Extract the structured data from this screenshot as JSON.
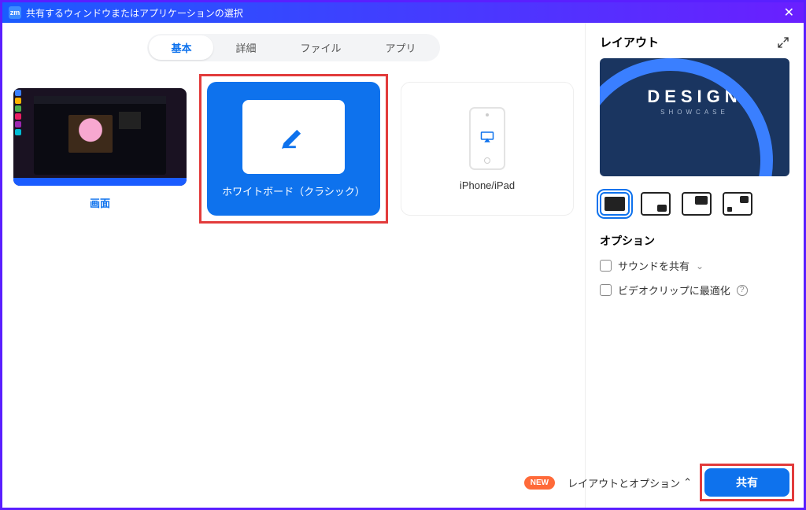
{
  "titlebar": {
    "logo": "zm",
    "title": "共有するウィンドウまたはアプリケーションの選択"
  },
  "tabs": [
    {
      "label": "基本",
      "active": true
    },
    {
      "label": "詳細",
      "active": false
    },
    {
      "label": "ファイル",
      "active": false
    },
    {
      "label": "アプリ",
      "active": false
    }
  ],
  "cards": {
    "screen": {
      "label": "画面"
    },
    "whiteboard": {
      "label": "ホワイトボード（クラシック）"
    },
    "iphone": {
      "label": "iPhone/iPad"
    }
  },
  "right": {
    "heading": "レイアウト",
    "preview": {
      "brand": "DESIGN",
      "sub": "SHOWCASE"
    },
    "options_heading": "オプション",
    "opt_sound": "サウンドを共有",
    "opt_video": "ビデオクリップに最適化"
  },
  "footer": {
    "new": "NEW",
    "layout_toggle": "レイアウトとオプション",
    "share": "共有"
  },
  "colors": {
    "primary": "#0e72ed",
    "highlight": "#e23b3b",
    "border": "#5a1fff"
  }
}
